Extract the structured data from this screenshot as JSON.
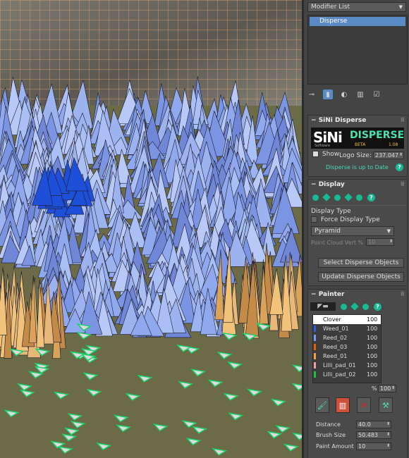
{
  "modifier_list": {
    "label": "Modifier List"
  },
  "stack": {
    "items": [
      {
        "label": "Disperse"
      }
    ]
  },
  "toolbar": {
    "icons": [
      "pin-icon",
      "show-end-result-icon",
      "make-unique-icon",
      "remove-modifier-icon",
      "configure-icon"
    ]
  },
  "sini_disperse": {
    "title": "SiNi Disperse",
    "logo_brand": "SiNi",
    "logo_sub": "Software",
    "logo_product": "DISPERSE",
    "beta": "BETA",
    "version": "1.08",
    "show_label": "Show",
    "logo_size_label": "Logo Size:",
    "logo_size_value": "237.047",
    "status": "Disperse is up to Date"
  },
  "display": {
    "title": "Display",
    "display_type_label": "Display Type",
    "force_display_type": "Force Display Type",
    "shape_value": "Pyramid",
    "point_cloud_label": "Point Cloud Vert %",
    "point_cloud_value": "10",
    "select_button": "Select Disperse Objects",
    "update_button": "Update Disperse Objects"
  },
  "painter": {
    "title": "Painter",
    "items": [
      {
        "name": "Clover",
        "value": "100",
        "color": "#ffffff"
      },
      {
        "name": "Weed_01",
        "value": "100",
        "color": "#2f5fe0"
      },
      {
        "name": "Reed_02",
        "value": "100",
        "color": "#7a9bf0"
      },
      {
        "name": "Reed_03",
        "value": "100",
        "color": "#e06010"
      },
      {
        "name": "Reed_01",
        "value": "100",
        "color": "#f0a040"
      },
      {
        "name": "Lilli_pad_01",
        "value": "100",
        "color": "#f0a0a0"
      },
      {
        "name": "Lilli_pad_02",
        "value": "100",
        "color": "#20c040"
      }
    ],
    "percent_label": "%",
    "percent_value": "100",
    "distance_label": "Distance",
    "distance_value": "40.0",
    "brush_size_label": "Brush Size",
    "brush_size_value": "50.483",
    "paint_amount_label": "Paint Amount",
    "paint_amount_value": "10"
  }
}
